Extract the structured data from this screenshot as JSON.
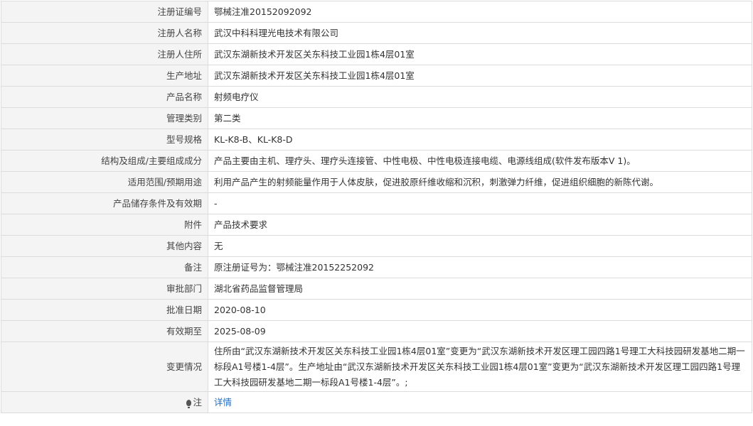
{
  "rows": [
    {
      "label": "注册证编号",
      "value": "鄂械注准20152092092"
    },
    {
      "label": "注册人名称",
      "value": "武汉中科科理光电技术有限公司"
    },
    {
      "label": "注册人住所",
      "value": "武汉东湖新技术开发区关东科技工业园1栋4层01室"
    },
    {
      "label": "生产地址",
      "value": "武汉东湖新技术开发区关东科技工业园1栋4层01室"
    },
    {
      "label": "产品名称",
      "value": "射频电疗仪"
    },
    {
      "label": "管理类别",
      "value": "第二类"
    },
    {
      "label": "型号规格",
      "value": "KL-K8-B、KL-K8-D"
    },
    {
      "label": "结构及组成/主要组成成分",
      "value": "产品主要由主机、理疗头、理疗头连接管、中性电极、中性电极连接电缆、电源线组成(软件发布版本V 1)。"
    },
    {
      "label": "适用范围/预期用途",
      "value": "利用产品产生的射频能量作用于人体皮肤，促进胶原纤维收缩和沉积，刺激弹力纤维，促进组织细胞的新陈代谢。"
    },
    {
      "label": "产品储存条件及有效期",
      "value": "-"
    },
    {
      "label": "附件",
      "value": "产品技术要求"
    },
    {
      "label": "其他内容",
      "value": "无"
    },
    {
      "label": "备注",
      "value": "原注册证号为：鄂械注准20152252092"
    },
    {
      "label": "审批部门",
      "value": "湖北省药品监督管理局"
    },
    {
      "label": "批准日期",
      "value": "2020-08-10"
    },
    {
      "label": "有效期至",
      "value": "2025-08-09"
    }
  ],
  "change": {
    "label": "变更情况",
    "value": "住所由“武汉东湖新技术开发区关东科技工业园1栋4层01室”变更为“武汉东湖新技术开发区理工园四路1号理工大科技园研发基地二期一标段A1号楼1-4层”。生产地址由“武汉东湖新技术开发区关东科技工业园1栋4层01室”变更为“武汉东湖新技术开发区理工园四路1号理工大科技园研发基地二期一标段A1号楼1-4层”。;"
  },
  "note": {
    "label": "注",
    "icon": "lightbulb-icon",
    "link_text": "详情"
  }
}
